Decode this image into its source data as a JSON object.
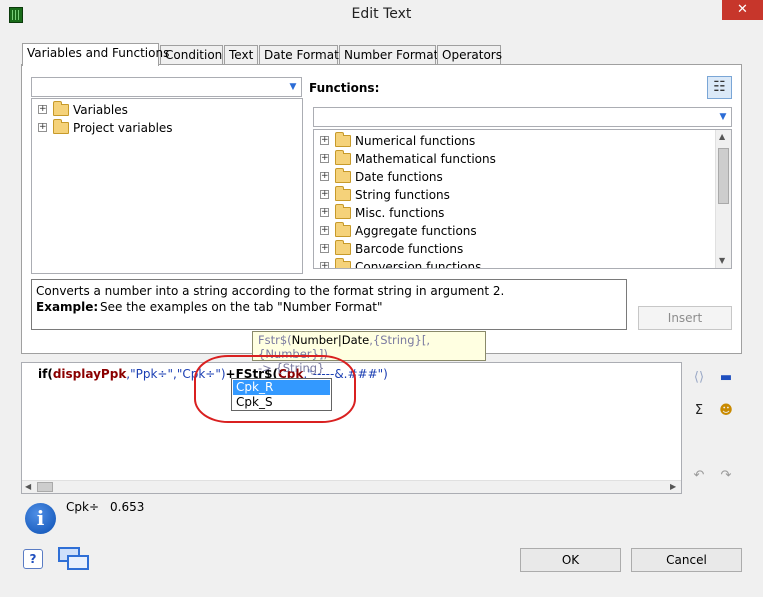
{
  "window": {
    "title": "Edit Text",
    "close_glyph": "✕"
  },
  "tabs": [
    {
      "label": "Variables and Functions",
      "active": true
    },
    {
      "label": "Condition"
    },
    {
      "label": "Text"
    },
    {
      "label": "Date Format"
    },
    {
      "label": "Number Format"
    },
    {
      "label": "Operators"
    }
  ],
  "variables": {
    "filter_value": "",
    "items": [
      {
        "label": "Variables"
      },
      {
        "label": "Project variables"
      }
    ]
  },
  "functions": {
    "heading": "Functions:",
    "filter_value": "",
    "items": [
      {
        "label": "Numerical functions"
      },
      {
        "label": "Mathematical functions"
      },
      {
        "label": "Date functions"
      },
      {
        "label": "String functions"
      },
      {
        "label": "Misc. functions"
      },
      {
        "label": "Aggregate functions"
      },
      {
        "label": "Barcode functions"
      },
      {
        "label": "Conversion functions"
      }
    ]
  },
  "description": {
    "line1": "Converts a number into a string according to the format string in argument 2.",
    "example_label": "Example:",
    "example_text": "See the examples on the tab \"Number Format\""
  },
  "insert_label": "Insert",
  "tooltip": {
    "line1_prefix": "Fstr$(",
    "line1_current": "Number|Date",
    "line1_rest": ",{String}[,{Number}])",
    "line2": "-> {String}"
  },
  "editor": {
    "code": {
      "if_kw": "if(",
      "var1": "displayPpk",
      "str1": ",\"Ppk÷\",\"Cpk÷\")",
      "plus": "+",
      "fstr": "FStr$(",
      "cpk": "Cpk",
      "str2": ",\"-----&.###\")"
    },
    "autocomplete": [
      {
        "label": "Cpk_R",
        "selected": true
      },
      {
        "label": "Cpk_S"
      }
    ]
  },
  "result": {
    "label": "Cpk÷",
    "value": "0.653"
  },
  "buttons": {
    "ok": "OK",
    "cancel": "Cancel"
  },
  "colors": {
    "accent": "#3399ff",
    "annotation": "#d92020"
  }
}
